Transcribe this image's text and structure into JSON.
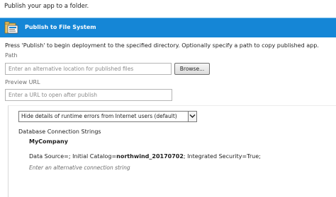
{
  "intro_text": "Publish your app to a folder.",
  "header": {
    "title": "Publish to File System",
    "icon": "publish-folder-icon",
    "bg_color": "#1586d6"
  },
  "description": "Press 'Publish' to begin deployment to the specified directory. Optionally specify a path to copy published app.",
  "path": {
    "label": "Path",
    "placeholder": "Enter an alternative location for published files",
    "value": "",
    "browse_label": "Browse..."
  },
  "preview": {
    "label": "Preview URL",
    "placeholder": "Enter a URL to open after publish",
    "value": ""
  },
  "errors_select": {
    "selected": "Hide details of runtime errors from Internet users (default)",
    "icon": "chevron-down-icon"
  },
  "database": {
    "heading": "Database Connection Strings",
    "company": "MyCompany",
    "conn_prefix": "Data Source=; Initial Catalog=",
    "conn_catalog": "northwind_20170702",
    "conn_suffix": "; Integrated Security=True;",
    "conn_placeholder": "Enter an alternative connection string"
  }
}
